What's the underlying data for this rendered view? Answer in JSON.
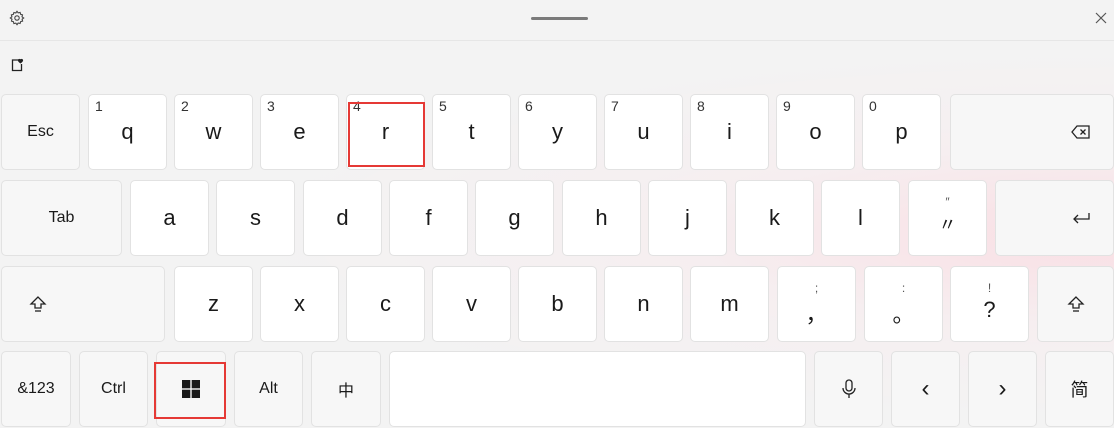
{
  "icons": {
    "settings": "gear-icon",
    "drag": "drag-handle-icon",
    "close": "close-icon",
    "clipboard": "clipboard-heart-icon",
    "backspace": "backspace-icon",
    "enter": "enter-icon",
    "shift": "shift-icon",
    "windows": "windows-logo-icon",
    "mic": "microphone-icon"
  },
  "row1": {
    "esc": "Esc",
    "keys": [
      {
        "num": "1",
        "char": "q"
      },
      {
        "num": "2",
        "char": "w"
      },
      {
        "num": "3",
        "char": "e"
      },
      {
        "num": "4",
        "char": "r"
      },
      {
        "num": "5",
        "char": "t"
      },
      {
        "num": "6",
        "char": "y"
      },
      {
        "num": "7",
        "char": "u"
      },
      {
        "num": "8",
        "char": "i"
      },
      {
        "num": "9",
        "char": "o"
      },
      {
        "num": "0",
        "char": "p"
      }
    ]
  },
  "row2": {
    "tab": "Tab",
    "keys": [
      "a",
      "s",
      "d",
      "f",
      "g",
      "h",
      "j",
      "k",
      "l"
    ],
    "quote": {
      "sup": "″",
      "main": "〃"
    }
  },
  "row3": {
    "keys": [
      "z",
      "x",
      "c",
      "v",
      "b",
      "n",
      "m"
    ],
    "comma": {
      "sup": ";",
      "main": "，"
    },
    "period": {
      "sup": ":",
      "main": "。"
    },
    "question": {
      "sup": "!",
      "main": "?"
    }
  },
  "row4": {
    "sym": "&123",
    "ctrl": "Ctrl",
    "alt": "Alt",
    "ime": "中",
    "left": "‹",
    "right": "›",
    "lang": "简"
  },
  "accent": {
    "highlight": "#e53935"
  }
}
